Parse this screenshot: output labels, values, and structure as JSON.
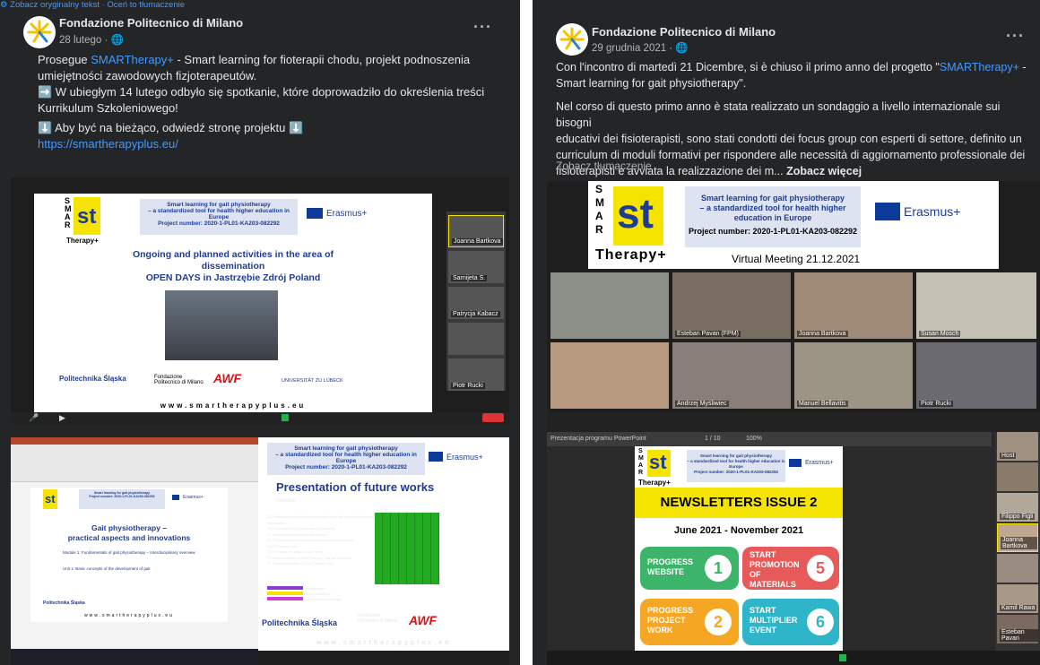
{
  "left_post": {
    "author": "Fondazione Politecnico di Milano",
    "date": "28 lutego",
    "body_prefix": "Prosegue ",
    "brand_link": "SMARTherapy+",
    "body_line1": " - Smart learning for fioterapii chodu, projekt podnoszenia",
    "body_line2": "umiejętności zawodowych fizjoterapeutów.",
    "body_line3": "➡️ W ubiegłym 14 lutego odbyło się spotkanie, które doprowadziło do określenia treści",
    "body_line4": "Kurrikulum Szkoleniowego!",
    "body_line5": "⬇️ Aby być na bieżąco, odwiedź stronę projektu ⬇️",
    "url": "https://smartherapyplus.eu/",
    "translate_links": "Zobacz oryginalny tekst · Oceń to tłumaczenie",
    "more": "···"
  },
  "right_post": {
    "author": "Fondazione Politecnico di Milano",
    "date": "29 grudnia 2021",
    "p1_prefix": "Con l'incontro di martedì 21 Dicembre, si è chiuso il primo anno del progetto \"",
    "p1_link": "SMARTherapy+",
    "p1_suffix": " -",
    "p1_line2": "Smart learning for gait physiotherapy\".",
    "p2_line1": "Nel corso di questo primo anno è stata realizzato un sondaggio a livello internazionale sui bisogni",
    "p2_line2": "educativi dei fisioterapisti, sono stati condotti dei focus group con esperti di settore, definito un",
    "p2_line3": "curriculum di moduli formativi per rispondere alle necessità di aggiornamento professionale dei",
    "p2_line4": "fisioterapisti e avviata la realizzazione dei m...",
    "see_more": "Zobacz więcej",
    "see_translation": "Zobacz tłumaczenie",
    "more": "···"
  },
  "slides": {
    "brand_letters": [
      "S",
      "M",
      "A",
      "R"
    ],
    "brand_st": "st",
    "brand_therapy": "Therapy+",
    "header_title": "Smart learning for gait physiotherapy",
    "header_sub": "– a standardized tool for health higher education in Europe",
    "project_no": "Project number: 2020-1-PL01-KA203-082292",
    "erasmus": "Erasmus+",
    "virtual_meeting": "Virtual Meeting 21.12.2021",
    "activities_title1": "Ongoing and planned activities in the area of",
    "activities_title2": "dissemination",
    "activities_title3": "OPEN DAYS in Jastrzębie Zdrój Poland",
    "logo_polit": "Politechnika Śląska",
    "logo_fond": "Fondazione Politecnico di Milano",
    "logo_awf": "AWF",
    "logo_lubeck": "UNIVERSITÄT ZU LÜBECK",
    "website": "www.smartherapyplus.eu",
    "gait_title1": "Gait physiotherapy –",
    "gait_title2": "practical aspects and innovations",
    "module1": "Module 1: Fundamentals of gait physiotherapy – Interdisciplinary overview",
    "unit1": "Unit 1: Basic concepts of the development of gait",
    "future_works": "Presentation of future works",
    "newsletter": "NEWSLETTERS ISSUE 2",
    "newsletter_range": "June 2021 - November 2021",
    "nl_items": [
      {
        "text": "PROGRESS WEBSITE",
        "num": "1",
        "color": "#3cb56a"
      },
      {
        "text": "START PROMOTION OF MATERIALS",
        "num": "5",
        "color": "#e85a5a"
      },
      {
        "text": "PROGRESS PROJECT WORK",
        "num": "2",
        "color": "#f5a623"
      },
      {
        "text": "START MULTIPLIER EVENT",
        "num": "6",
        "color": "#2fb5c9"
      }
    ]
  },
  "participants_left": [
    "Joanna Bartkova",
    "Sarnijeta S.",
    "Patrycja Kabacz",
    "",
    "Piotr Rucki"
  ],
  "participants_right_grid": [
    "",
    "Esteban Pavan (FPM)",
    "Joanna Bartkova",
    "Susan Mosch",
    "",
    "Andrzej Myśliwiec",
    "Manuel Bellavitis",
    "Piotr Rucki"
  ],
  "participants_right_col": [
    "Host",
    "",
    "Filippo Figli",
    "Joanna Bartkova",
    "",
    "Kamil Rawa",
    "Esteban Pavan"
  ],
  "gantt_legend": [
    "Management",
    "Project meetings",
    "Virtual project meetings",
    "Multiplier Events"
  ],
  "gantt_year": "2022",
  "gantt_months": [
    "Feb",
    "Mar",
    "Apr",
    "May",
    "Jun",
    "Jul",
    "Aug",
    "Sep"
  ],
  "gantt_rows": [
    "T2.1 Obtaining diversified factual materials in the field of gait physiotherapy case studies",
    "T2.2 Development of content training scenarios",
    "T2.3 Development of the training contents",
    "T2.4 Transformation of the training contents into a interactive SMARTherapy+ tool",
    "T2.5 Creation of a platform open space",
    "T2.6 Implementation of SMARTherapy+ tool into e-platform",
    "T2.7 Internal validation of SMARTherapy+ tool"
  ],
  "timetable_label": "Timetable",
  "pdf_label": "Prezentacja programu PowerPoint",
  "pdf_page": "1 / 10",
  "pdf_zoom": "100%",
  "colors": {
    "fb_bg": "#242526",
    "fb_link": "#4599ff",
    "slide_blue": "#1f3c94",
    "brand_yellow": "#f5e400"
  }
}
